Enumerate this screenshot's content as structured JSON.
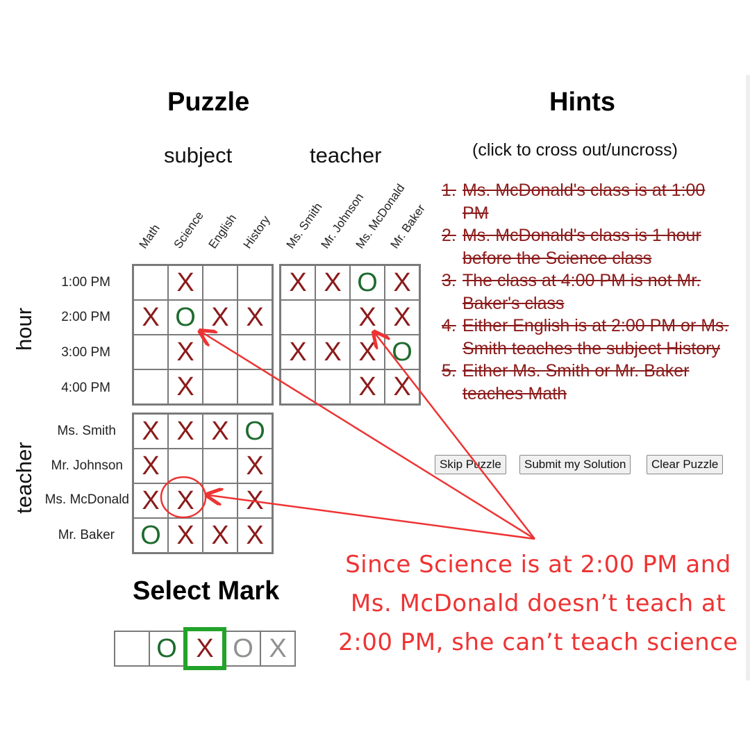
{
  "titles": {
    "puzzle": "Puzzle",
    "hints": "Hints",
    "select_mark": "Select Mark"
  },
  "column_groups": {
    "subject": "subject",
    "teacher": "teacher"
  },
  "subject_columns": [
    "Math",
    "Science",
    "English",
    "History"
  ],
  "teacher_columns": [
    "Ms. Smith",
    "Mr. Johnson",
    "Ms. McDonald",
    "Mr. Baker"
  ],
  "row_groups": {
    "hour": "hour",
    "teacher": "teacher"
  },
  "hour_rows": [
    "1:00 PM",
    "2:00 PM",
    "3:00 PM",
    "4:00 PM"
  ],
  "teacher_rows": [
    "Ms. Smith",
    "Mr. Johnson",
    "Ms. McDonald",
    "Mr. Baker"
  ],
  "grids": {
    "hour_subject": [
      [
        "",
        "X",
        "",
        ""
      ],
      [
        "X",
        "O",
        "X",
        "X"
      ],
      [
        "",
        "X",
        "",
        ""
      ],
      [
        "",
        "X",
        "",
        ""
      ]
    ],
    "hour_teacher": [
      [
        "X",
        "X",
        "O",
        "X"
      ],
      [
        "",
        "",
        "X",
        "X"
      ],
      [
        "X",
        "X",
        "X",
        "O"
      ],
      [
        "",
        "",
        "X",
        "X"
      ]
    ],
    "teacher_subject": [
      [
        "X",
        "X",
        "X",
        "O"
      ],
      [
        "X",
        "",
        "",
        "X"
      ],
      [
        "X",
        "X",
        "",
        "X"
      ],
      [
        "O",
        "X",
        "X",
        "X"
      ]
    ]
  },
  "hints": {
    "subtitle": "(click to cross out/uncross)",
    "items": [
      {
        "num": "1.",
        "text": "Ms. McDonald's class is at 1:00 PM",
        "crossed": true
      },
      {
        "num": "2.",
        "text": "Ms. McDonald's class is 1 hour before the Science class",
        "crossed": true
      },
      {
        "num": "3.",
        "text": "The class at 4:00 PM is not Mr. Baker's class",
        "crossed": true
      },
      {
        "num": "4.",
        "text": "Either English is at 2:00 PM or Ms. Smith teaches the subject History",
        "crossed": true
      },
      {
        "num": "5.",
        "text": "Either Ms. Smith or Mr. Baker teaches Math",
        "crossed": true
      }
    ]
  },
  "buttons": {
    "skip": "Skip Puzzle",
    "submit": "Submit my Solution",
    "clear": "Clear Puzzle"
  },
  "marks": [
    {
      "label": "",
      "name": "blank",
      "selected": false
    },
    {
      "label": "O",
      "name": "o",
      "selected": false
    },
    {
      "label": "X",
      "name": "x",
      "selected": true
    },
    {
      "label": "O",
      "name": "o-light",
      "selected": false
    },
    {
      "label": "X",
      "name": "x-light",
      "selected": false
    }
  ],
  "annotation": {
    "lines": [
      "Since Science is at 2:00 PM and",
      "Ms. McDonald doesn’t teach at",
      "2:00 PM, she can’t teach science"
    ],
    "color": "#ee3333"
  },
  "colors": {
    "x_mark": "#8b1a1a",
    "o_mark": "#1e6b2e",
    "selected_mark_border": "#22a32a",
    "hint_text": "#8b1a1a"
  }
}
